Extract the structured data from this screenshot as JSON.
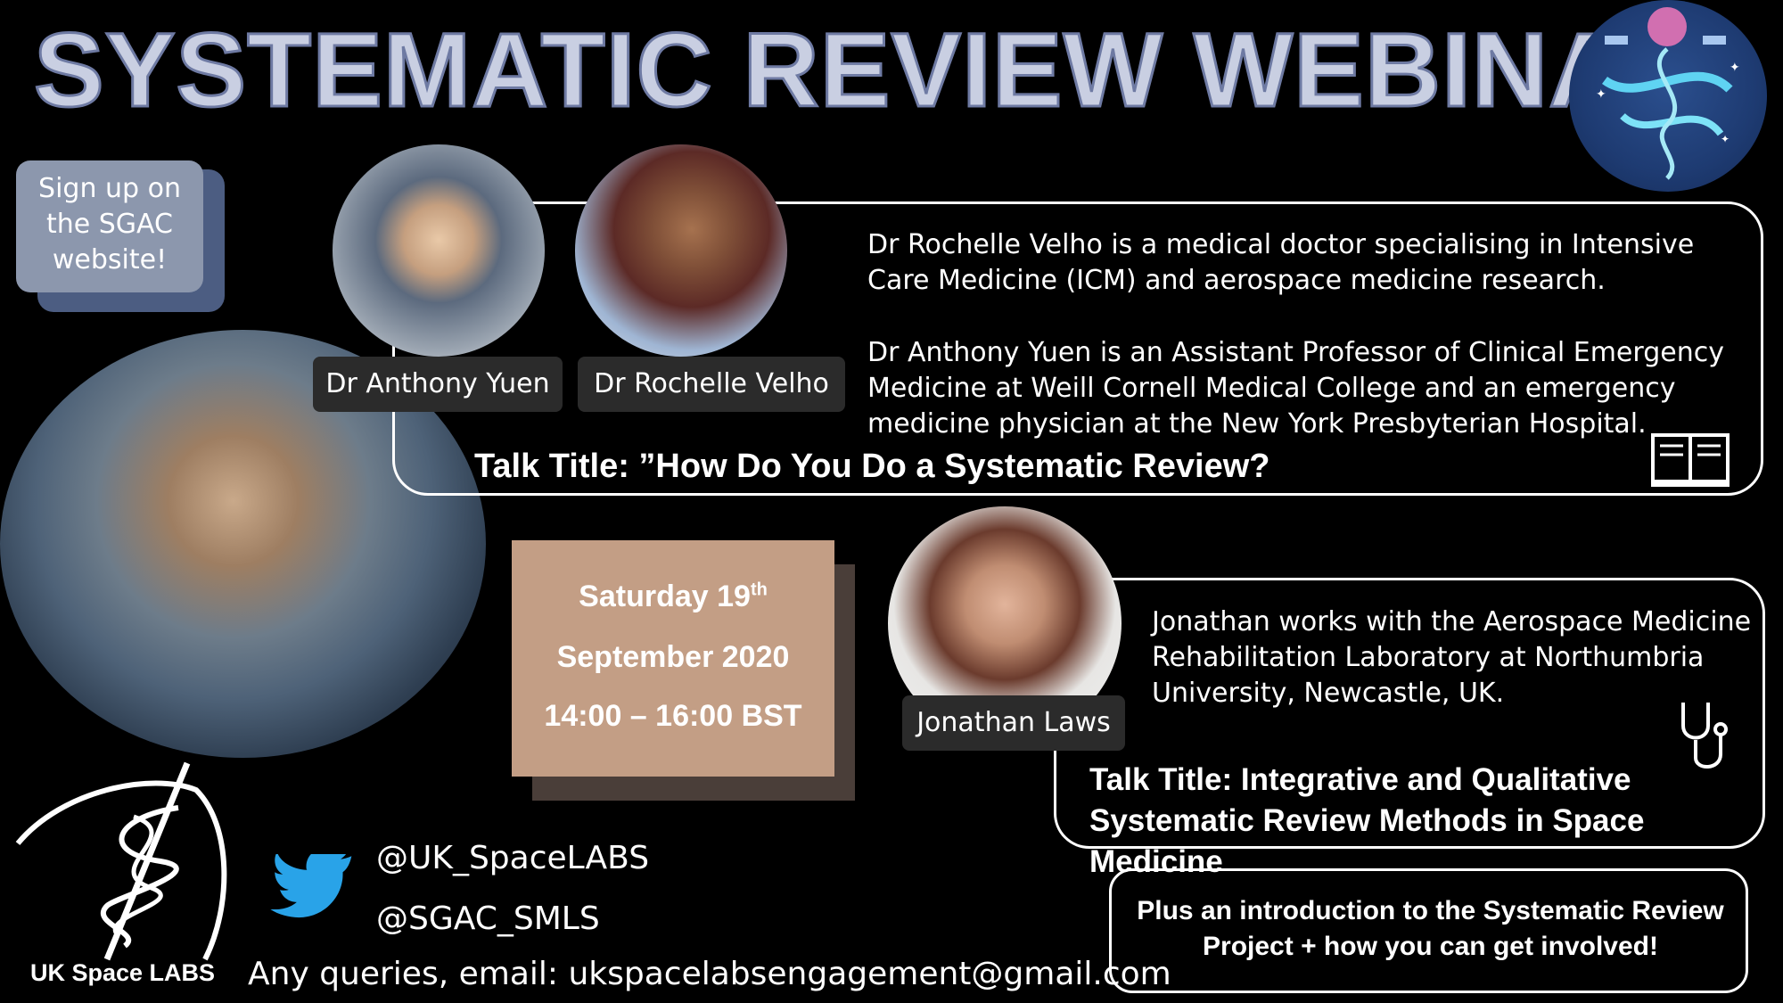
{
  "title": "SYSTEMATIC REVIEW WEBINAR",
  "signup": [
    "Sign up on",
    "the SGAC",
    "website!"
  ],
  "speakers": {
    "anthony": "Dr Anthony Yuen",
    "rochelle": "Dr Rochelle Velho",
    "jonathan": "Jonathan Laws"
  },
  "bios": {
    "rochelle": "Dr Rochelle Velho is a medical doctor specialising in Intensive Care Medicine (ICM) and aerospace medicine research.",
    "anthony": "Dr Anthony Yuen is an Assistant Professor of Clinical Emergency Medicine at Weill Cornell Medical College and an emergency medicine physician at the New York Presbyterian Hospital.",
    "jonathan": "Jonathan works with the Aerospace Medicine Rehabilitation Laboratory at Northumbria University, Newcastle, UK."
  },
  "talks": {
    "talk1": "Talk Title: ”How Do You Do a Systematic Review?",
    "talk2": "Talk Title: Integrative and Qualitative Systematic Review Methods in Space Medicine"
  },
  "plus_note": "Plus an introduction to the Systematic Review Project + how you can get involved!",
  "date": {
    "day": "Saturday 19",
    "suffix": "th",
    "month_year": "September 2020",
    "time": "14:00 – 16:00 BST"
  },
  "social": {
    "handle1": "@UK_SpaceLABS",
    "handle2": "@SGAC_SMLS",
    "email": "Any queries, email: ukspacelabsengagement@gmail.com"
  },
  "org": "UK Space LABS",
  "icons": [
    "twitter-icon",
    "book-icon",
    "stethoscope-icon",
    "globe-image",
    "space-medicine-logo",
    "uk-space-labs-logo"
  ]
}
